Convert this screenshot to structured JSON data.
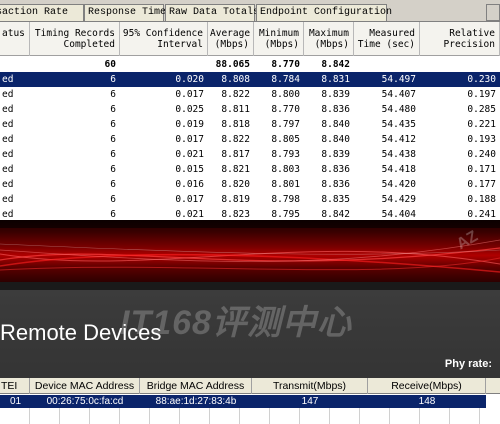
{
  "tabs": [
    "ansaction Rate",
    "Response Time",
    "Raw Data Totals",
    "Endpoint Configuration"
  ],
  "results_table": {
    "headers": [
      [
        "atus",
        ""
      ],
      [
        "Timing Records",
        "Completed"
      ],
      [
        "95% Confidence",
        "Interval"
      ],
      [
        "Average",
        "(Mbps)"
      ],
      [
        "Minimum",
        "(Mbps)"
      ],
      [
        "Maximum",
        "(Mbps)"
      ],
      [
        "Measured",
        "Time (sec)"
      ],
      [
        "Relative",
        "Precision"
      ]
    ],
    "totals": [
      "",
      "60",
      "",
      "88.065",
      "8.770",
      "8.842",
      "",
      ""
    ],
    "rows": [
      [
        "ed",
        "6",
        "0.020",
        "8.808",
        "8.784",
        "8.831",
        "54.497",
        "0.230"
      ],
      [
        "ed",
        "6",
        "0.017",
        "8.822",
        "8.800",
        "8.839",
        "54.407",
        "0.197"
      ],
      [
        "ed",
        "6",
        "0.025",
        "8.811",
        "8.770",
        "8.836",
        "54.480",
        "0.285"
      ],
      [
        "ed",
        "6",
        "0.019",
        "8.818",
        "8.797",
        "8.840",
        "54.435",
        "0.221"
      ],
      [
        "ed",
        "6",
        "0.017",
        "8.822",
        "8.805",
        "8.840",
        "54.412",
        "0.193"
      ],
      [
        "ed",
        "6",
        "0.021",
        "8.817",
        "8.793",
        "8.839",
        "54.438",
        "0.240"
      ],
      [
        "ed",
        "6",
        "0.015",
        "8.821",
        "8.803",
        "8.836",
        "54.418",
        "0.171"
      ],
      [
        "ed",
        "6",
        "0.016",
        "8.820",
        "8.801",
        "8.836",
        "54.420",
        "0.177"
      ],
      [
        "ed",
        "6",
        "0.017",
        "8.819",
        "8.798",
        "8.835",
        "54.429",
        "0.188"
      ],
      [
        "ed",
        "6",
        "0.021",
        "8.823",
        "8.795",
        "8.842",
        "54.404",
        "0.241"
      ]
    ],
    "selected_row": 0
  },
  "banner": {
    "watermark_text": "IT168评测中心",
    "corner_text": "AZ"
  },
  "panel": {
    "title": "Remote Devices",
    "phy_rate_label": "Phy rate:"
  },
  "device_table": {
    "headers": [
      "TEI",
      "Device MAC Address",
      "Bridge MAC Address",
      "Transmit(Mbps)",
      "Receive(Mbps)"
    ],
    "rows": [
      [
        "01",
        "00:26:75:0c:fa:cd",
        "88:ae:1d:27:83:4b",
        "147",
        "148"
      ]
    ]
  },
  "colors": {
    "selection": "#0a246a",
    "banner_red": "#b00000",
    "panel_bg": "#3a3a3a"
  }
}
